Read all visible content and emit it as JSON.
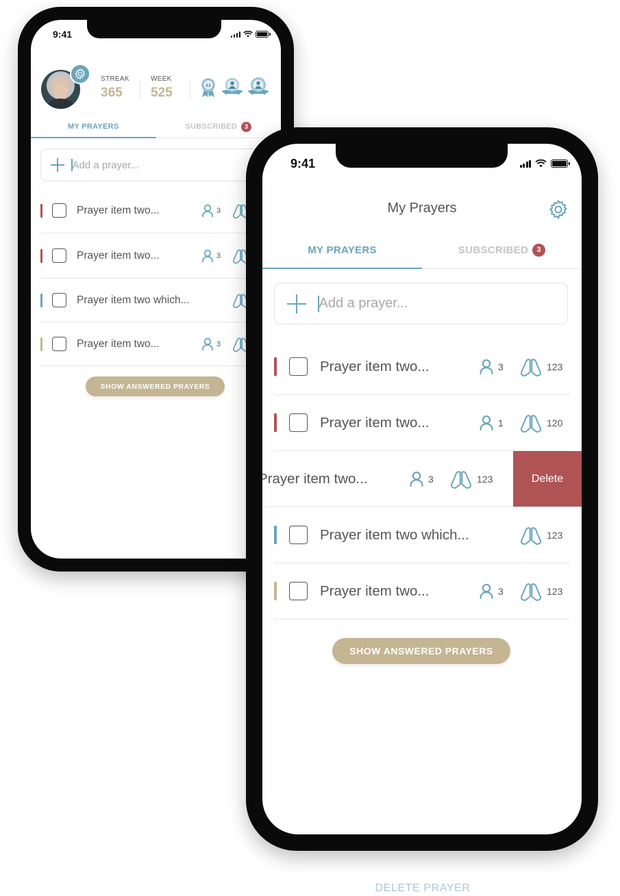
{
  "colors": {
    "accent": "#6aa5ba",
    "gold": "#c4b593",
    "danger": "#b05354",
    "priority_high": "#b05354",
    "priority_medium": "#6aa5ba",
    "priority_low": "#c4b593"
  },
  "back_phone": {
    "status": {
      "time": "9:41"
    },
    "profile": {
      "streak_label": "STREAK",
      "streak_value": "365",
      "week_label": "WEEK",
      "week_value": "525",
      "badges": [
        "prayer-badge-icon",
        "person-badge-icon",
        "person-badge-icon"
      ]
    },
    "tabs": [
      {
        "label": "MY PRAYERS",
        "active": true
      },
      {
        "label": "SUBSCRIBED",
        "badge": "3",
        "active": false
      }
    ],
    "add_placeholder": "Add a prayer...",
    "prayers": [
      {
        "title": "Prayer item two...",
        "priority": "high",
        "followers": "3"
      },
      {
        "title": "Prayer item two...",
        "priority": "high",
        "followers": "3"
      },
      {
        "title": "Prayer item two which...",
        "priority": "medium",
        "followers": null
      },
      {
        "title": "Prayer item two...",
        "priority": "low",
        "followers": "3"
      }
    ],
    "answered_button": "SHOW ANSWERED PRAYERS"
  },
  "front_phone": {
    "status": {
      "time": "9:41"
    },
    "header_title": "My Prayers",
    "tabs": [
      {
        "label": "MY PRAYERS",
        "active": true
      },
      {
        "label": "SUBSCRIBED",
        "badge": "3",
        "active": false
      }
    ],
    "add_placeholder": "Add a prayer...",
    "prayers": [
      {
        "title": "Prayer item two...",
        "priority": "high",
        "followers": "3",
        "prayed": "123"
      },
      {
        "title": "Prayer item two...",
        "priority": "high",
        "followers": "1",
        "prayed": "120"
      },
      {
        "title": "Prayer item two...",
        "priority": "high",
        "followers": "3",
        "prayed": "123",
        "swiped": true,
        "swipe_action": "Delete"
      },
      {
        "title": "Prayer item two which...",
        "priority": "medium",
        "followers": null,
        "prayed": "123"
      },
      {
        "title": "Prayer item two...",
        "priority": "low",
        "followers": "3",
        "prayed": "123"
      }
    ],
    "answered_button": "SHOW ANSWERED PRAYERS"
  },
  "caption": "DELETE PRAYER"
}
